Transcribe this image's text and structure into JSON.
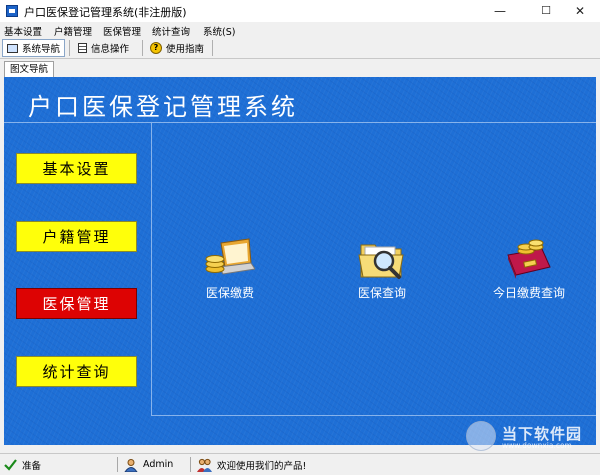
{
  "window": {
    "title": "户口医保登记管理系统(非注册版)",
    "minimize_glyph": "—",
    "maximize_glyph": "☐",
    "close_glyph": "✕"
  },
  "menu": [
    "基本设置",
    "户籍管理",
    "医保管理",
    "统计查询",
    "系统(S)"
  ],
  "toolbar": [
    {
      "label": "系统导航",
      "icon": "monitor-icon"
    },
    {
      "label": "信息操作",
      "icon": "document-icon"
    },
    {
      "label": "使用指南",
      "icon": "help-icon"
    }
  ],
  "tab": {
    "label": "图文导航"
  },
  "main": {
    "title": "户口医保登记管理系统",
    "nav": [
      {
        "label": "基本设置",
        "color": "#ffff0a"
      },
      {
        "label": "户籍管理",
        "color": "#ffff0a"
      },
      {
        "label": "医保管理",
        "color": "#dd0303"
      },
      {
        "label": "统计查询",
        "color": "#ffff0a"
      }
    ],
    "functions": [
      {
        "label": "医保缴费",
        "icon": "laptop-coins-icon"
      },
      {
        "label": "医保查询",
        "icon": "folder-search-icon"
      },
      {
        "label": "今日缴费查询",
        "icon": "wallet-coins-icon"
      }
    ]
  },
  "status": {
    "ready": "准备",
    "user": "Admin",
    "message": "欢迎使用我们的产品!"
  },
  "watermark": {
    "text": "当下软件园",
    "url": "www.downxia.com"
  },
  "colors": {
    "background": "#1e6fd6",
    "nav_yellow": "#ffff0a",
    "nav_red": "#dd0303"
  }
}
